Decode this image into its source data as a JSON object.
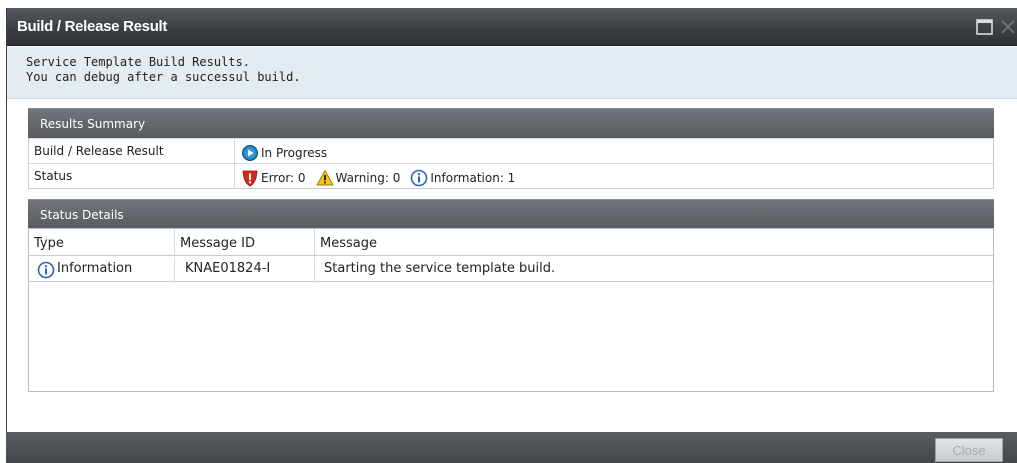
{
  "dialog": {
    "title": "Build / Release Result",
    "description_line1": "Service Template Build Results.",
    "description_line2": "You can debug after a successul build."
  },
  "summary": {
    "header": "Results Summary",
    "result_label": "Build / Release Result",
    "result_value": "In Progress",
    "status_label": "Status",
    "error_text": "Error: 0",
    "warning_text": "Warning: 0",
    "information_text": "Information: 1"
  },
  "details": {
    "header": "Status Details",
    "columns": [
      "Type",
      "Message ID",
      "Message"
    ],
    "rows": [
      {
        "type": "Information",
        "message_id": "KNAE01824-I",
        "message": "Starting the service template build."
      }
    ]
  },
  "footer": {
    "close_label": "Close"
  },
  "icons": {
    "in_progress": "play-circle-icon",
    "error": "error-shield-icon",
    "warning": "warning-triangle-icon",
    "information": "info-circle-icon",
    "maximize": "maximize-icon",
    "close": "close-icon"
  },
  "colors": {
    "titlebar": "#3a3d41",
    "section_header": "#62666b",
    "description_bg": "#e4ebf1",
    "in_progress": "#1f7fb8",
    "error": "#d12a1f",
    "warning": "#f2c21b",
    "information": "#2b63b8"
  }
}
